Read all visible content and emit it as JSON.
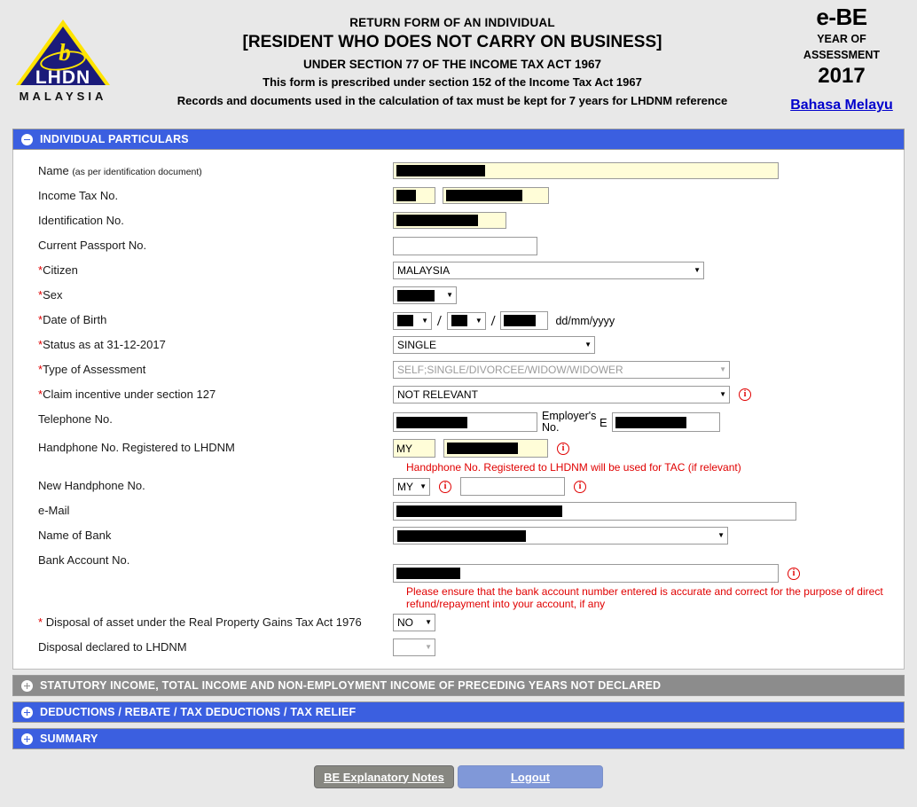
{
  "header": {
    "logo": {
      "name": "LHDN",
      "country": "MALAYSIA"
    },
    "title_line1": "RETURN FORM OF AN INDIVIDUAL",
    "title_line2": "[RESIDENT WHO DOES NOT CARRY ON BUSINESS]",
    "title_line3": "UNDER SECTION 77 OF THE INCOME TAX ACT 1967",
    "title_line4": "This form is prescribed under section 152 of the Income Tax Act 1967",
    "title_line5": "Records and documents used in the calculation of tax must be kept for 7 years for LHDNM reference",
    "form_code": "e-BE",
    "year_label_line1": "YEAR OF",
    "year_label_line2": "ASSESSMENT",
    "year": "2017",
    "language_link": "Bahasa Melayu"
  },
  "sections": {
    "individual_particulars": "INDIVIDUAL PARTICULARS",
    "statutory_income": "STATUTORY INCOME, TOTAL INCOME AND NON-EMPLOYMENT INCOME OF PRECEDING YEARS NOT DECLARED",
    "deductions": "DEDUCTIONS / REBATE / TAX DEDUCTIONS / TAX RELIEF",
    "summary": "SUMMARY"
  },
  "fields": {
    "name": {
      "label": "Name",
      "sublabel": "(as per identification document)",
      "value": "",
      "redacted": true
    },
    "income_tax_no": {
      "label": "Income Tax No.",
      "prefix_value": "",
      "number_value": ""
    },
    "identification_no": {
      "label": "Identification No.",
      "value": ""
    },
    "current_passport_no": {
      "label": "Current Passport No.",
      "value": ""
    },
    "citizen": {
      "label": "Citizen",
      "required": true,
      "value": "MALAYSIA"
    },
    "sex": {
      "label": "Sex",
      "required": true,
      "value": ""
    },
    "date_of_birth": {
      "label": "Date of Birth",
      "required": true,
      "day": "",
      "month": "",
      "year": "",
      "hint": "dd/mm/yyyy"
    },
    "status": {
      "label": "Status as at 31-12-2017",
      "required": true,
      "value": "SINGLE"
    },
    "type_of_assessment": {
      "label": "Type of Assessment",
      "required": true,
      "value": "SELF;SINGLE/DIVORCEE/WIDOW/WIDOWER",
      "disabled": true
    },
    "claim_incentive": {
      "label": "Claim incentive under section 127",
      "required": true,
      "value": "NOT RELEVANT"
    },
    "telephone_no": {
      "label": "Telephone No.",
      "value": ""
    },
    "employers_no": {
      "label": "Employer's No.",
      "prefix": "E",
      "value": ""
    },
    "handphone_lhdnm": {
      "label": "Handphone No. Registered to LHDNM",
      "country_code": "MY",
      "value": "",
      "note": "Handphone No. Registered to LHDNM will be used for TAC (if relevant)"
    },
    "new_handphone": {
      "label": "New Handphone No.",
      "country_code": "MY",
      "value": ""
    },
    "email": {
      "label": "e-Mail",
      "value": ""
    },
    "name_of_bank": {
      "label": "Name of Bank",
      "value": ""
    },
    "bank_account_no": {
      "label": "Bank Account No.",
      "value": "",
      "note": "Please ensure that the bank account number entered is accurate and correct for the purpose of direct refund/repayment into your account, if any"
    },
    "disposal_of_asset": {
      "label": "Disposal of asset under the Real Property Gains Tax Act 1976",
      "required": true,
      "value": "NO"
    },
    "disposal_declared": {
      "label": "Disposal declared to LHDNM",
      "value": ""
    }
  },
  "footer": {
    "notes_button": "BE Explanatory Notes",
    "logout_button": "Logout"
  },
  "colors": {
    "section_blue": "#3b5fe0",
    "section_gray": "#8c8c8c",
    "field_yellow": "#fffdd8",
    "alert_red": "#e00000",
    "link_blue": "#0000cc"
  }
}
